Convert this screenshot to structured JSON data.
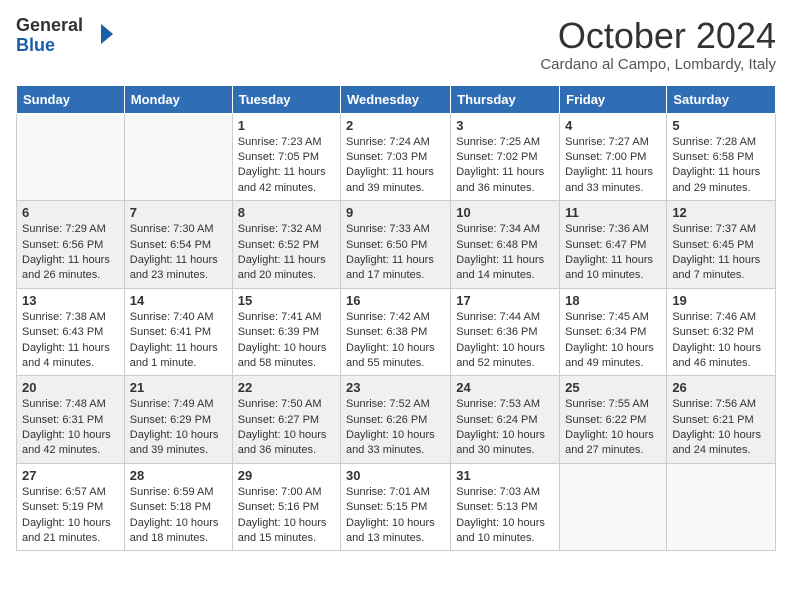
{
  "logo": {
    "general": "General",
    "blue": "Blue"
  },
  "title": "October 2024",
  "subtitle": "Cardano al Campo, Lombardy, Italy",
  "headers": [
    "Sunday",
    "Monday",
    "Tuesday",
    "Wednesday",
    "Thursday",
    "Friday",
    "Saturday"
  ],
  "weeks": [
    [
      {
        "day": "",
        "sunrise": "",
        "sunset": "",
        "daylight": ""
      },
      {
        "day": "",
        "sunrise": "",
        "sunset": "",
        "daylight": ""
      },
      {
        "day": "1",
        "sunrise": "Sunrise: 7:23 AM",
        "sunset": "Sunset: 7:05 PM",
        "daylight": "Daylight: 11 hours and 42 minutes."
      },
      {
        "day": "2",
        "sunrise": "Sunrise: 7:24 AM",
        "sunset": "Sunset: 7:03 PM",
        "daylight": "Daylight: 11 hours and 39 minutes."
      },
      {
        "day": "3",
        "sunrise": "Sunrise: 7:25 AM",
        "sunset": "Sunset: 7:02 PM",
        "daylight": "Daylight: 11 hours and 36 minutes."
      },
      {
        "day": "4",
        "sunrise": "Sunrise: 7:27 AM",
        "sunset": "Sunset: 7:00 PM",
        "daylight": "Daylight: 11 hours and 33 minutes."
      },
      {
        "day": "5",
        "sunrise": "Sunrise: 7:28 AM",
        "sunset": "Sunset: 6:58 PM",
        "daylight": "Daylight: 11 hours and 29 minutes."
      }
    ],
    [
      {
        "day": "6",
        "sunrise": "Sunrise: 7:29 AM",
        "sunset": "Sunset: 6:56 PM",
        "daylight": "Daylight: 11 hours and 26 minutes."
      },
      {
        "day": "7",
        "sunrise": "Sunrise: 7:30 AM",
        "sunset": "Sunset: 6:54 PM",
        "daylight": "Daylight: 11 hours and 23 minutes."
      },
      {
        "day": "8",
        "sunrise": "Sunrise: 7:32 AM",
        "sunset": "Sunset: 6:52 PM",
        "daylight": "Daylight: 11 hours and 20 minutes."
      },
      {
        "day": "9",
        "sunrise": "Sunrise: 7:33 AM",
        "sunset": "Sunset: 6:50 PM",
        "daylight": "Daylight: 11 hours and 17 minutes."
      },
      {
        "day": "10",
        "sunrise": "Sunrise: 7:34 AM",
        "sunset": "Sunset: 6:48 PM",
        "daylight": "Daylight: 11 hours and 14 minutes."
      },
      {
        "day": "11",
        "sunrise": "Sunrise: 7:36 AM",
        "sunset": "Sunset: 6:47 PM",
        "daylight": "Daylight: 11 hours and 10 minutes."
      },
      {
        "day": "12",
        "sunrise": "Sunrise: 7:37 AM",
        "sunset": "Sunset: 6:45 PM",
        "daylight": "Daylight: 11 hours and 7 minutes."
      }
    ],
    [
      {
        "day": "13",
        "sunrise": "Sunrise: 7:38 AM",
        "sunset": "Sunset: 6:43 PM",
        "daylight": "Daylight: 11 hours and 4 minutes."
      },
      {
        "day": "14",
        "sunrise": "Sunrise: 7:40 AM",
        "sunset": "Sunset: 6:41 PM",
        "daylight": "Daylight: 11 hours and 1 minute."
      },
      {
        "day": "15",
        "sunrise": "Sunrise: 7:41 AM",
        "sunset": "Sunset: 6:39 PM",
        "daylight": "Daylight: 10 hours and 58 minutes."
      },
      {
        "day": "16",
        "sunrise": "Sunrise: 7:42 AM",
        "sunset": "Sunset: 6:38 PM",
        "daylight": "Daylight: 10 hours and 55 minutes."
      },
      {
        "day": "17",
        "sunrise": "Sunrise: 7:44 AM",
        "sunset": "Sunset: 6:36 PM",
        "daylight": "Daylight: 10 hours and 52 minutes."
      },
      {
        "day": "18",
        "sunrise": "Sunrise: 7:45 AM",
        "sunset": "Sunset: 6:34 PM",
        "daylight": "Daylight: 10 hours and 49 minutes."
      },
      {
        "day": "19",
        "sunrise": "Sunrise: 7:46 AM",
        "sunset": "Sunset: 6:32 PM",
        "daylight": "Daylight: 10 hours and 46 minutes."
      }
    ],
    [
      {
        "day": "20",
        "sunrise": "Sunrise: 7:48 AM",
        "sunset": "Sunset: 6:31 PM",
        "daylight": "Daylight: 10 hours and 42 minutes."
      },
      {
        "day": "21",
        "sunrise": "Sunrise: 7:49 AM",
        "sunset": "Sunset: 6:29 PM",
        "daylight": "Daylight: 10 hours and 39 minutes."
      },
      {
        "day": "22",
        "sunrise": "Sunrise: 7:50 AM",
        "sunset": "Sunset: 6:27 PM",
        "daylight": "Daylight: 10 hours and 36 minutes."
      },
      {
        "day": "23",
        "sunrise": "Sunrise: 7:52 AM",
        "sunset": "Sunset: 6:26 PM",
        "daylight": "Daylight: 10 hours and 33 minutes."
      },
      {
        "day": "24",
        "sunrise": "Sunrise: 7:53 AM",
        "sunset": "Sunset: 6:24 PM",
        "daylight": "Daylight: 10 hours and 30 minutes."
      },
      {
        "day": "25",
        "sunrise": "Sunrise: 7:55 AM",
        "sunset": "Sunset: 6:22 PM",
        "daylight": "Daylight: 10 hours and 27 minutes."
      },
      {
        "day": "26",
        "sunrise": "Sunrise: 7:56 AM",
        "sunset": "Sunset: 6:21 PM",
        "daylight": "Daylight: 10 hours and 24 minutes."
      }
    ],
    [
      {
        "day": "27",
        "sunrise": "Sunrise: 6:57 AM",
        "sunset": "Sunset: 5:19 PM",
        "daylight": "Daylight: 10 hours and 21 minutes."
      },
      {
        "day": "28",
        "sunrise": "Sunrise: 6:59 AM",
        "sunset": "Sunset: 5:18 PM",
        "daylight": "Daylight: 10 hours and 18 minutes."
      },
      {
        "day": "29",
        "sunrise": "Sunrise: 7:00 AM",
        "sunset": "Sunset: 5:16 PM",
        "daylight": "Daylight: 10 hours and 15 minutes."
      },
      {
        "day": "30",
        "sunrise": "Sunrise: 7:01 AM",
        "sunset": "Sunset: 5:15 PM",
        "daylight": "Daylight: 10 hours and 13 minutes."
      },
      {
        "day": "31",
        "sunrise": "Sunrise: 7:03 AM",
        "sunset": "Sunset: 5:13 PM",
        "daylight": "Daylight: 10 hours and 10 minutes."
      },
      {
        "day": "",
        "sunrise": "",
        "sunset": "",
        "daylight": ""
      },
      {
        "day": "",
        "sunrise": "",
        "sunset": "",
        "daylight": ""
      }
    ]
  ]
}
